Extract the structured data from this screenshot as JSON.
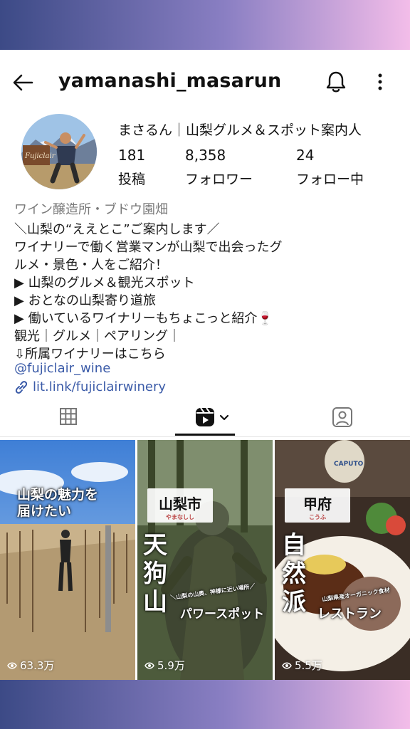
{
  "header": {
    "username": "yamanashi_masarun"
  },
  "profile": {
    "display_name": "まさるん｜山梨グルメ＆スポット案内人",
    "stats": [
      {
        "value": "181",
        "label": "投稿"
      },
      {
        "value": "8,358",
        "label": "フォロワー"
      },
      {
        "value": "24",
        "label": "フォロー中"
      }
    ],
    "category": "ワイン醸造所・ブドウ園畑",
    "bio_lines": [
      "＼山梨の“ええとこ”ご案内します／",
      "ワイナリーで働く営業マンが山梨で出会ったグ",
      "ルメ・景色・人をご紹介！",
      "▶ 山梨のグルメ＆観光スポット",
      "▶ おとなの山梨寄り道旅",
      "▶ 働いているワイナリーもちょこっと紹介🍷",
      "観光｜グルメ｜ペアリング｜",
      "⇩所属ワイナリーはこちら"
    ],
    "mention": "@fujiclair_wine",
    "link": "lit.link/fujiclairwinery",
    "avatar_sign": "Fujiclair"
  },
  "tabs": [
    {
      "icon": "grid-icon"
    },
    {
      "icon": "reels-icon",
      "active": true
    },
    {
      "icon": "tagged-icon"
    }
  ],
  "reels": [
    {
      "caption": "山梨の魅力を\n届けたい",
      "views": "63.3万"
    },
    {
      "tag": "山梨市",
      "tag_reading": "やまなしし",
      "title_vertical": [
        "天",
        "狗",
        "山"
      ],
      "subtitle": "パワースポット",
      "note": "＼山梨の山奥、神様に近い場所／",
      "views": "5.9万"
    },
    {
      "tag": "甲府",
      "tag_reading": "こうふ",
      "title_vertical": [
        "自",
        "然",
        "派"
      ],
      "subtitle": "レストラン",
      "note": "山梨県産オーガニック食材",
      "sign": "CAPUTO",
      "views": "5.5万"
    }
  ]
}
